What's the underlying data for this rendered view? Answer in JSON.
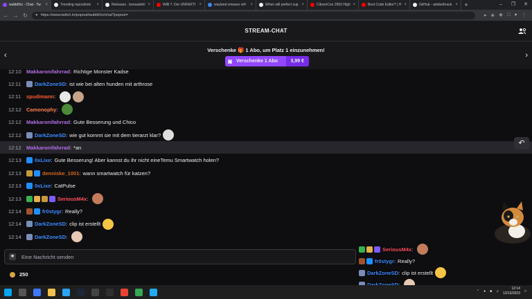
{
  "browser": {
    "tabs": [
      {
        "label": "wubbl0rz - Chat - Tw",
        "color": "#9147ff",
        "active": true
      },
      {
        "label": "Trending repositorie",
        "color": "#f0f0f0",
        "active": false
      },
      {
        "label": "Releases · bensadeh/",
        "color": "#f0f0f0",
        "active": false
      },
      {
        "label": "Willi 7: Der UNFERTI",
        "color": "#ff0000",
        "active": false
      },
      {
        "label": "wayland vmware refr",
        "color": "#4285f4",
        "active": false
      },
      {
        "label": "When will perfect sup",
        "color": "#f0f0f0",
        "active": false
      },
      {
        "label": "CitizenCon 2953 High",
        "color": "#ff0000",
        "active": false
      },
      {
        "label": "Best Code Editor? | H",
        "color": "#ff0000",
        "active": false
      },
      {
        "label": "GitHub - adobe/brack",
        "color": "#f0f0f0",
        "active": false
      }
    ],
    "new_tab": "+",
    "url": "https://www.twitch.tv/popout/wubbl0rz/chat?popout=",
    "window_controls": [
      "–",
      "❐",
      "✕"
    ]
  },
  "chat": {
    "title": "STREAM-CHAT",
    "gift_text": "Verschenke 🎁 1 Abo, um Platz 1 einzunehmen!",
    "gift_button_label": "Verschenke 1 Abo",
    "gift_button_price": "3,99 €",
    "messages": [
      {
        "time": "12:10",
        "badges": [],
        "user": "Makkaronifahrrad",
        "color": "#b66ee8",
        "text": "Richtige Monster Kadse",
        "emotes": []
      },
      {
        "time": "12:11",
        "badges": [
          "#7a8cb8"
        ],
        "user": "DarkZoneSD",
        "color": "#3d8bff",
        "text": "ist wie bei alten hunden mit arthrose",
        "emotes": []
      },
      {
        "time": "12:11",
        "badges": [],
        "user": "spudimann",
        "color": "#ff5733",
        "text": "",
        "emotes": [
          "#e8e8e8",
          "#c9a28a"
        ]
      },
      {
        "time": "12:12",
        "badges": [],
        "user": "Camonophy",
        "color": "#ff7f50",
        "text": "",
        "emotes": [
          "#4c8a3a"
        ]
      },
      {
        "time": "12:12",
        "badges": [],
        "user": "Makkaronifahrrad",
        "color": "#b66ee8",
        "text": "Gute Besserung und Chico",
        "emotes": []
      },
      {
        "time": "12:12",
        "badges": [
          "#7a8cb8"
        ],
        "user": "DarkZoneSD",
        "color": "#3d8bff",
        "text": "wie gut kommt sie mit dem tierarzt klar?",
        "emotes": [
          "#dddddd"
        ]
      },
      {
        "time": "12:12",
        "badges": [],
        "user": "Makkaronifahrrad",
        "color": "#b66ee8",
        "text": "*an",
        "emotes": [],
        "highlight": true
      },
      {
        "time": "12:13",
        "badges": [
          "#1e90ff"
        ],
        "user": "0xLixe",
        "color": "#3d8bff",
        "text": "Gute Besserung! Aber kannst du ihr nicht eineTemu Smartwatch holen?",
        "emotes": []
      },
      {
        "time": "12:13",
        "badges": [
          "#c49a3a",
          "#1e90ff"
        ],
        "user": "denniske_1001",
        "color": "#d2691e",
        "text": "wann smartwatch für katzen?",
        "emotes": []
      },
      {
        "time": "12:13",
        "badges": [
          "#1e90ff"
        ],
        "user": "0xLixe",
        "color": "#3d8bff",
        "text": "CatPulse",
        "emotes": []
      },
      {
        "time": "12:13",
        "badges": [
          "#37b24d",
          "#e8b04a",
          "#c49a3a",
          "#7a5cff"
        ],
        "user": "SeriousM4x",
        "color": "#ff4f5e",
        "text": "",
        "emotes": [
          "#c27c5c"
        ]
      },
      {
        "time": "12:14",
        "badges": [
          "#a0522d",
          "#1e90ff"
        ],
        "user": "fr0stygr",
        "color": "#3d8bff",
        "text": "Really?",
        "emotes": []
      },
      {
        "time": "12:14",
        "badges": [
          "#7a8cb8"
        ],
        "user": "DarkZoneSD",
        "color": "#3d8bff",
        "text": "clip ist erstellt",
        "emotes": [
          "#f4c542"
        ]
      },
      {
        "time": "12:14",
        "badges": [
          "#7a8cb8"
        ],
        "user": "DarkZoneSD",
        "color": "#3d8bff",
        "text": "",
        "emotes": [
          "#e6c9b5"
        ]
      }
    ],
    "input_placeholder": "Eine Nachricht senden",
    "points": "250"
  },
  "overlay": {
    "messages": [
      {
        "badges": [
          "#37b24d",
          "#e8b04a",
          "#7a5cff"
        ],
        "user": "SeriousM4x",
        "color": "#ff4f5e",
        "text": "",
        "emotes": [
          "#c27c5c"
        ]
      },
      {
        "badges": [
          "#a0522d",
          "#1e90ff"
        ],
        "user": "fr0stygr",
        "color": "#3d8bff",
        "text": "Really?",
        "emotes": []
      },
      {
        "badges": [
          "#7a8cb8"
        ],
        "user": "DarkZoneSD",
        "color": "#3d8bff",
        "text": "clip ist erstellt",
        "emotes": [
          "#f4c542"
        ]
      },
      {
        "badges": [
          "#7a8cb8"
        ],
        "user": "DarkZoneSD",
        "color": "#3d8bff",
        "text": "",
        "emotes": [
          "#e6c9b5"
        ]
      }
    ]
  },
  "taskbar": {
    "icons": [
      {
        "name": "windows-start-icon",
        "color": "#00a4ef"
      },
      {
        "name": "task-view-icon",
        "color": "#555555"
      },
      {
        "name": "terminal-icon",
        "color": "#3b78ff"
      },
      {
        "name": "file-explorer-icon",
        "color": "#f2c14e"
      },
      {
        "name": "edge-icon",
        "color": "#2aa4f4"
      },
      {
        "name": "steam-icon",
        "color": "#1b2838"
      },
      {
        "name": "terminal-app-icon",
        "color": "#444444"
      },
      {
        "name": "obs-icon",
        "color": "#302e31"
      },
      {
        "name": "chrome-icon",
        "color": "#e94235"
      },
      {
        "name": "chrome-alt-icon",
        "color": "#34a853"
      },
      {
        "name": "vscode-icon",
        "color": "#23a9f2"
      }
    ],
    "time": "12:14",
    "date": "12/13/2023"
  }
}
